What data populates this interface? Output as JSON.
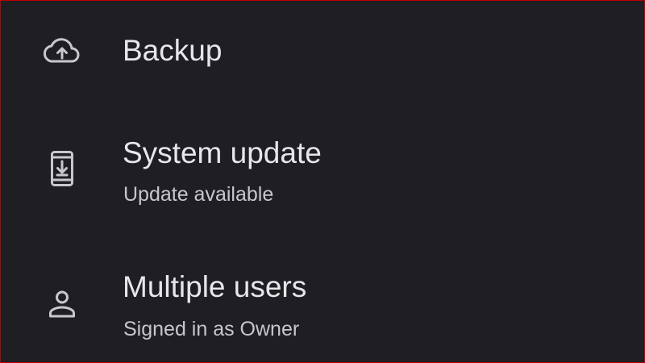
{
  "settings": {
    "items": [
      {
        "icon": "cloud-upload-icon",
        "title": "Backup",
        "subtitle": ""
      },
      {
        "icon": "system-update-icon",
        "title": "System update",
        "subtitle": "Update available"
      },
      {
        "icon": "person-icon",
        "title": "Multiple users",
        "subtitle": "Signed in as Owner"
      }
    ]
  },
  "colors": {
    "background": "#1f1f23",
    "title_text": "#e8e6ea",
    "subtitle_text": "#c8c6cc",
    "icon": "#c9c7cd",
    "frame_border": "#c00000"
  }
}
